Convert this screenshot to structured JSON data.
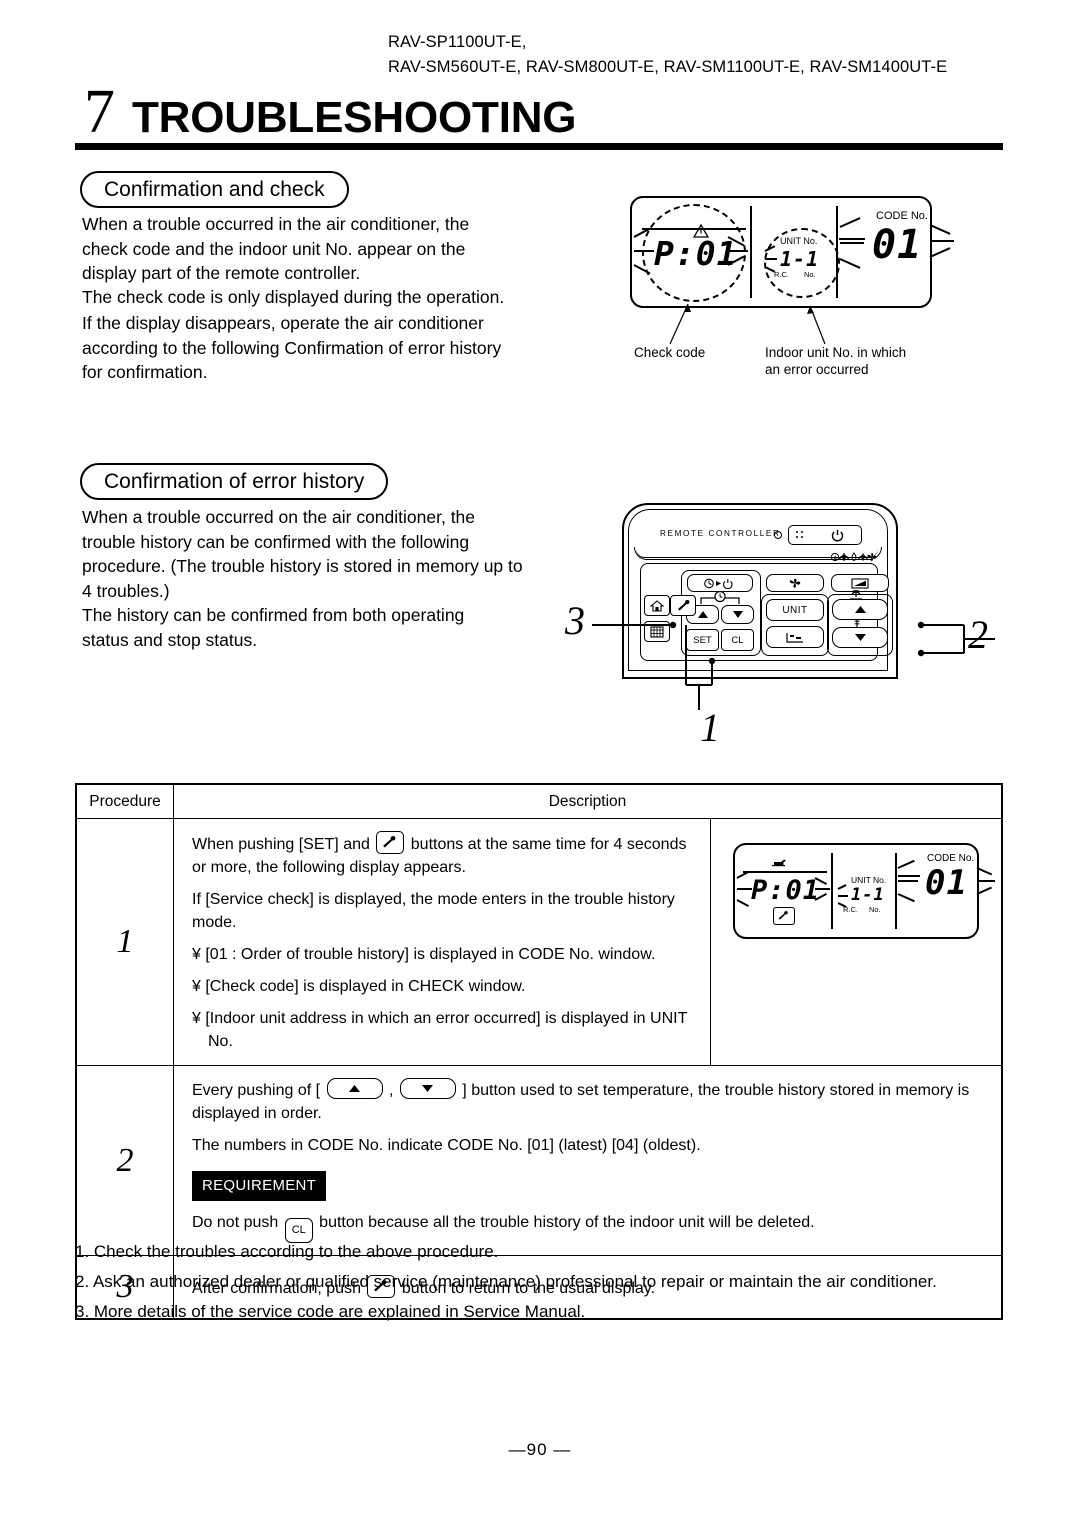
{
  "header": {
    "model_line_1": "RAV-SP1100UT-E,",
    "model_line_2": "RAV-SM560UT-E, RAV-SM800UT-E, RAV-SM1100UT-E, RAV-SM1400UT-E",
    "chapter_number": "7",
    "chapter_title": "TROUBLESHOOTING"
  },
  "section1": {
    "heading": "Confirmation and check",
    "p1": "When a trouble occurred in the air conditioner, the check code and the indoor unit No. appear on the display part of the remote controller.",
    "p2": "The check code is only displayed during the operation.",
    "p3": "If the display disappears, operate the air conditioner according to the following  Confirmation of error history  for confirmation."
  },
  "lcd_top": {
    "check_code": "P:01",
    "unit_no_label": "UNIT No.",
    "unit_no_value": "1-1",
    "rc_label": "R.C.",
    "no_label": "No.",
    "code_no_label": "CODE No.",
    "code_no_value": "01",
    "caption_left": "Check code",
    "caption_right_line1": "Indoor unit No. in which",
    "caption_right_line2": "an error occurred",
    "warning_icon": "warning-triangle-icon"
  },
  "section2": {
    "heading": "Confirmation of error history",
    "p1": "When a trouble occurred on the air conditioner, the trouble history can be confirmed with the following procedure. (The trouble history is stored in memory up to 4 troubles.)",
    "p2": "The history can be confirmed from both operating status and stop status."
  },
  "remote": {
    "brand_label": "REMOTE CONTROLLER",
    "power_icon": "power-icon",
    "buttons": {
      "timer_power": "timer-power-icon",
      "up": "up-arrow-icon",
      "down": "down-arrow-icon",
      "set": "SET",
      "cl": "CL",
      "fan": "fan-icon",
      "unit": "UNIT",
      "mode": "mode-icon",
      "louver": "louver-icon",
      "temp_up": "up-arrow-icon",
      "temp_down": "down-arrow-icon",
      "vent": "vent-icon",
      "filter": "filter-icon",
      "service": "wrench-icon",
      "home": "home-icon"
    },
    "mode_icons": "Ⓐ ❋ ◊ ❊ ✻",
    "callout_1": "1",
    "callout_2": "2",
    "callout_3": "3"
  },
  "table": {
    "header": {
      "procedure": "Procedure",
      "description": "Description"
    },
    "rows": [
      {
        "num": "1",
        "lines": [
          {
            "type": "mixed",
            "pre": "When pushing [SET] and ",
            "icon": "wrench-icon",
            "post": " buttons at the same time for 4 seconds or more, the following display appears."
          },
          {
            "type": "text",
            "text": "If [Service check] is displayed, the mode enters in the trouble history mode."
          },
          {
            "type": "text",
            "text": "¥ [01 : Order of trouble history] is displayed in CODE No. window."
          },
          {
            "type": "text",
            "text": "¥ [Check code] is displayed in CHECK window."
          },
          {
            "type": "text",
            "text": "¥ [Indoor unit address in which an error occurred] is displayed in UNIT No."
          }
        ],
        "lcd": {
          "check_code": "P:01",
          "unit_no_label": "UNIT No.",
          "unit_no_value": "1-1",
          "rc_label": "R.C.",
          "no_label": "No.",
          "code_no_label": "CODE No.",
          "code_no_value": "01",
          "oil_icon": "oil-can-icon",
          "wrench_icon": "wrench-icon"
        }
      },
      {
        "num": "2",
        "line1_pre": "Every pushing of [ ",
        "line1_mid": " , ",
        "line1_post": " ] button used to set temperature, the trouble history stored in memory is displayed in order.",
        "line2": "The numbers in CODE No. indicate CODE No.  [01] (latest)      [04] (oldest).",
        "requirement_badge": "REQUIREMENT",
        "line3_pre": "Do not push ",
        "line3_btn": "CL",
        "line3_post": " button because all the trouble history of the indoor unit will be deleted."
      },
      {
        "num": "3",
        "pre": "After confirmation, push ",
        "icon": "wrench-icon",
        "post": " button to return to the usual display."
      }
    ]
  },
  "notes": [
    "1.  Check the troubles according to the above procedure.",
    "2.  Ask an authorized dealer or qualified service (maintenance) professional to repair or maintain the air conditioner.",
    "3.  More details of the service code are explained in Service Manual."
  ],
  "footer": {
    "page_number": "—90 —"
  }
}
